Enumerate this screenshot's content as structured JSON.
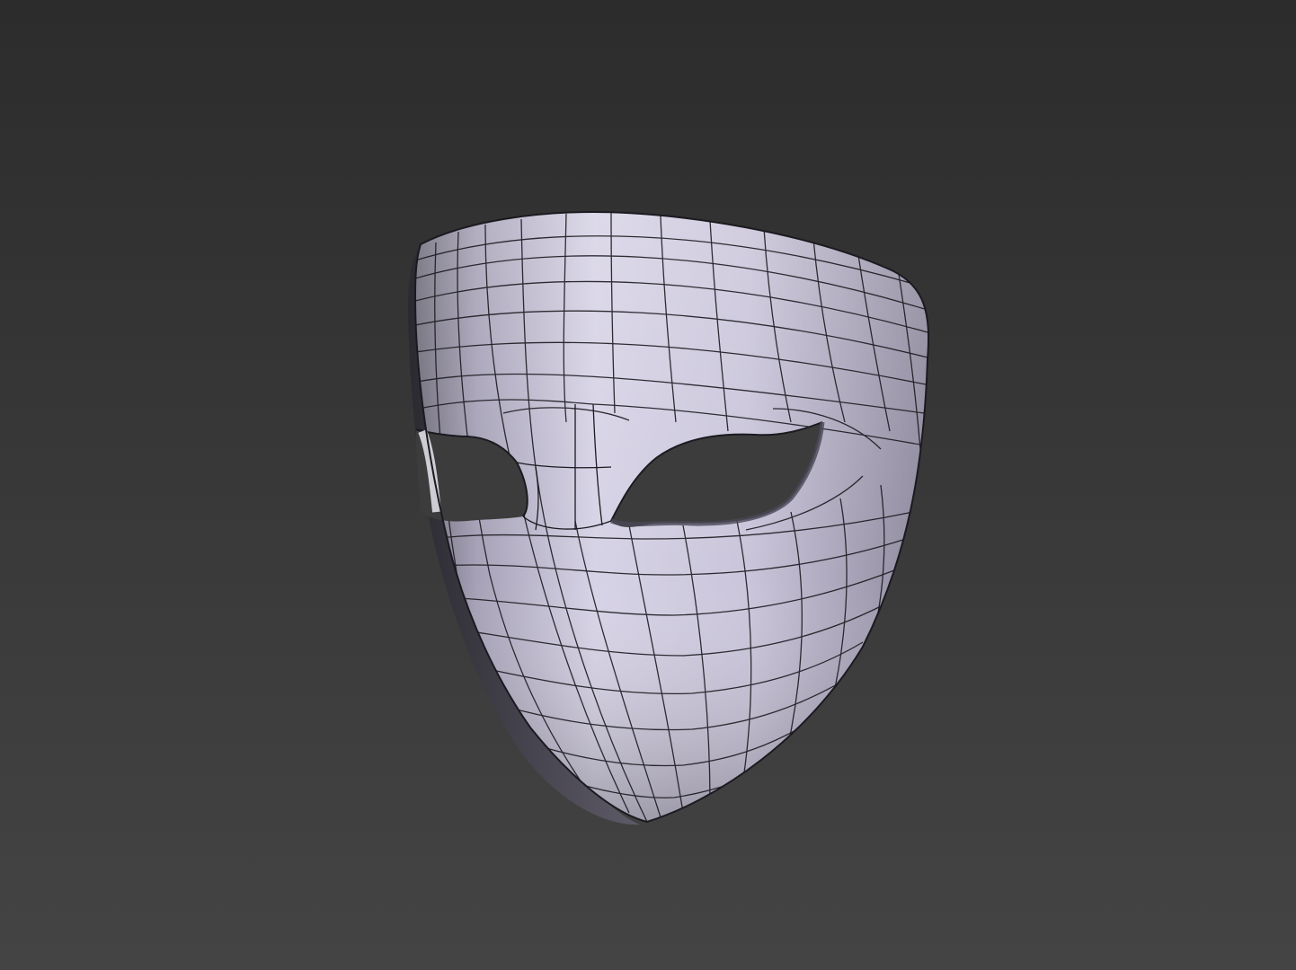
{
  "viewport": {
    "background_top": "#2c2c2c",
    "background_bottom": "#444444",
    "model": {
      "name": "face-mask",
      "display_mode": "shaded-with-wireframe",
      "surface_color": "#b3adc4",
      "highlight_color": "#dcd9ea",
      "shadow_color": "#3a3840",
      "wire_color": "#1a1a1f"
    }
  }
}
